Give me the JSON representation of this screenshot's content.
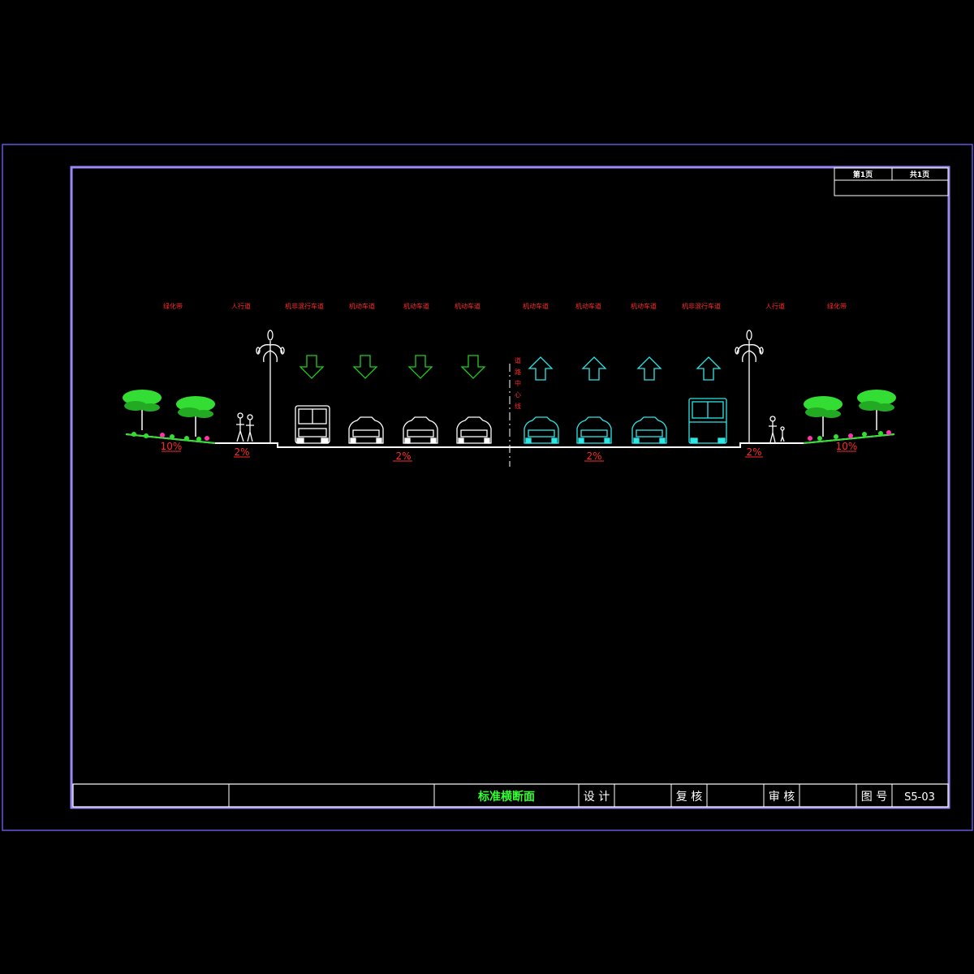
{
  "page_info": {
    "page_label": "第1页",
    "total_label": "共1页"
  },
  "lane_labels": [
    "绿化带",
    "人行道",
    "机非混行车道",
    "机动车道",
    "机动车道",
    "机动车道",
    "机动车道",
    "机动车道",
    "机动车道",
    "机非混行车道",
    "人行道",
    "绿化带"
  ],
  "centerline_label": [
    "道",
    "路",
    "中",
    "心",
    "线"
  ],
  "slopes": [
    "10%",
    "2%",
    "2%",
    "2%",
    "2%",
    "10%"
  ],
  "title_block": {
    "drawing_title": "标准横断面",
    "design_label": "设 计",
    "check_label": "复 核",
    "review_label": "审 核",
    "drawing_no_label": "图 号",
    "drawing_no": "S5-03"
  },
  "colors": {
    "frame": "#9b87f5",
    "line": "#ffffff",
    "label": "#ff2a2a",
    "arrow_down": "#22cc22",
    "arrow_up": "#2ee6e6",
    "vehicle_left": "#ffffff",
    "vehicle_right": "#2ee6e6",
    "tree": "#33dd33",
    "flower": "#ff33aa",
    "title_green": "#33ff33"
  }
}
